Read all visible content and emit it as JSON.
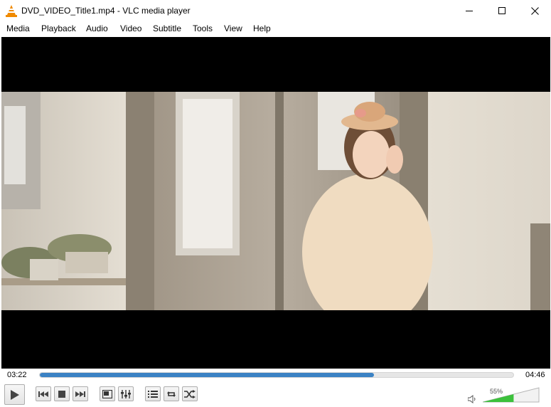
{
  "window": {
    "title": "DVD_VIDEO_Title1.mp4 - VLC media player",
    "icon": "vlc-cone-icon"
  },
  "menu": [
    "Media",
    "Playback",
    "Audio",
    "Video",
    "Subtitle",
    "Tools",
    "View",
    "Help"
  ],
  "playback": {
    "elapsed": "03:22",
    "total": "04:46",
    "progress_fraction": 0.705
  },
  "volume": {
    "label": "55%",
    "level_fraction": 0.55
  },
  "controls": [
    "play-icon",
    "previous-icon",
    "stop-icon",
    "next-icon",
    "fullscreen-icon",
    "extended-settings-icon",
    "playlist-icon",
    "loop-icon",
    "shuffle-icon",
    "speaker-icon"
  ],
  "colors": {
    "accent": "#3b82c4",
    "volume_fill": "#3cc13c",
    "video_background": "#000000"
  }
}
